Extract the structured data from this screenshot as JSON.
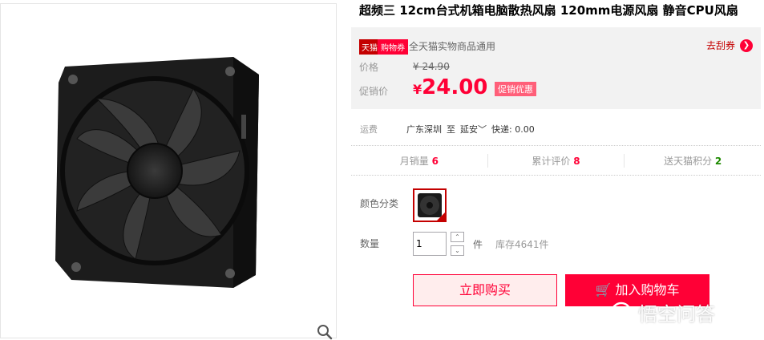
{
  "product": {
    "title": "超频三 12cm台式机箱电脑散热风扇 120mm电源风扇 静音CPU风扇"
  },
  "coupon": {
    "tag_tmall": "天猫",
    "tag_coupon": "购物券",
    "description": "全天猫实物商品通用",
    "link_label": "去刮券",
    "arrow_icon": "chevron-right-icon"
  },
  "price": {
    "label": "价格",
    "currency": "¥",
    "original": "24.90",
    "promo_label": "促销价",
    "promo": "24.00",
    "promo_badge": "促销优惠"
  },
  "shipping": {
    "label": "运费",
    "from": "广东深圳",
    "to_prefix": "至",
    "to": "延安",
    "method": "快递: 0.00"
  },
  "stats": [
    {
      "label": "月销量",
      "value": "6"
    },
    {
      "label": "累计评价",
      "value": "8"
    },
    {
      "label": "送天猫积分",
      "value": "2"
    }
  ],
  "options": {
    "color_label": "颜色分类",
    "qty_label": "数量",
    "qty_value": "1",
    "qty_unit": "件",
    "stock": "库存4641件"
  },
  "actions": {
    "buy_now": "立即购买",
    "add_cart": "加入购物车"
  },
  "watermark": {
    "text": "悟空问答"
  },
  "colors": {
    "accent": "#ff0036",
    "tmall_red": "#c40000"
  }
}
